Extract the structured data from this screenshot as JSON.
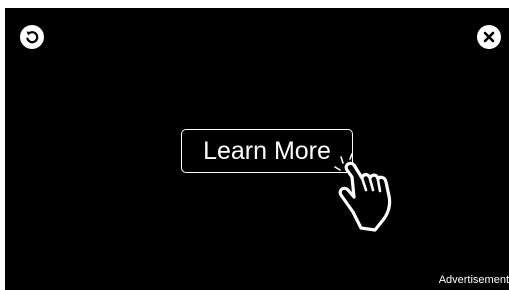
{
  "ad": {
    "cta_label": "Learn More",
    "advertisement_label": "Advertisement"
  },
  "icons": {
    "replay": "replay-icon",
    "close": "close-icon",
    "pointer": "pointing-hand-icon"
  },
  "colors": {
    "background": "#000000",
    "foreground": "#ffffff"
  }
}
